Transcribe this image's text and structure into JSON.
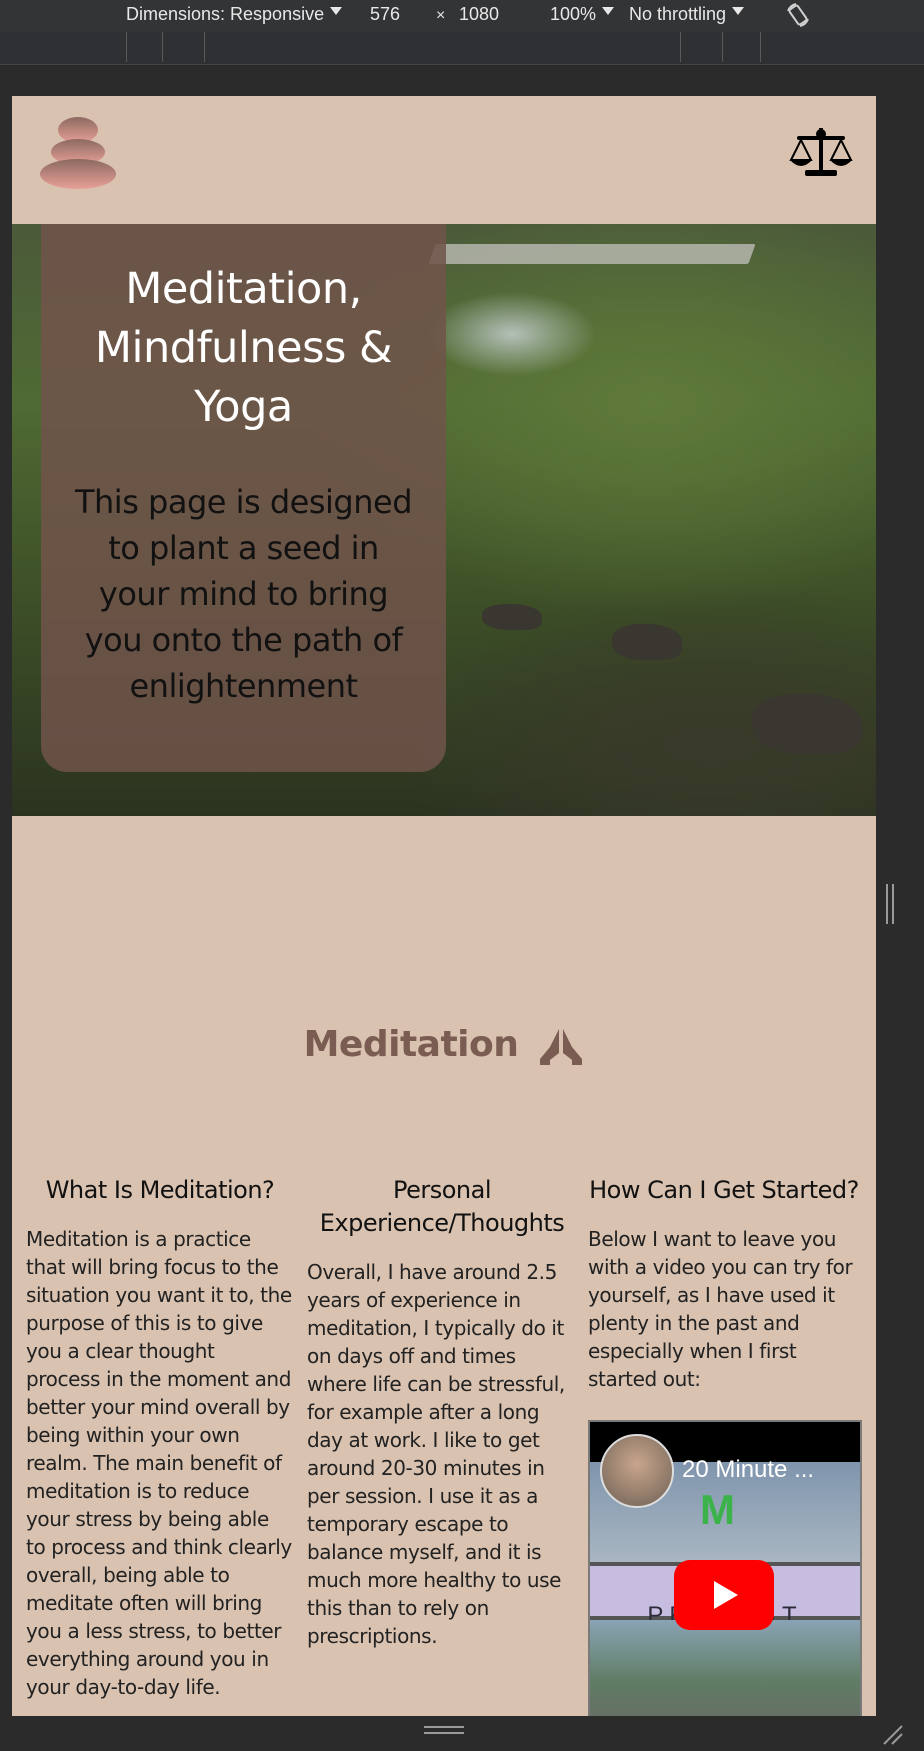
{
  "devtools": {
    "dimensions_label": "Dimensions: Responsive",
    "width": "576",
    "times": "×",
    "height": "1080",
    "zoom": "100%",
    "throttling": "No throttling",
    "icons": [
      "chevron-down-icon",
      "rotate-icon",
      "resize-handle-icon"
    ]
  },
  "site": {
    "icons": [
      "stones-logo-icon",
      "scale-icon",
      "praying-hands-icon"
    ],
    "hero": {
      "title": "Meditation, Mindfulness & Yoga",
      "subtitle": "This page is designed to plant a seed in your mind to bring you onto the path of enlightenment"
    },
    "section_title": "Meditation",
    "columns": [
      {
        "heading": "What Is Meditation?",
        "body": "Meditation is a practice that will bring focus to the situation you want it to, the purpose of this is to give you a clear thought process in the moment and better your mind overall by being within your own realm. The main benefit of meditation is to reduce your stress by being able to process and think clearly overall, being able to meditate often will bring you a less stress, to better everything around you in your day-to-day life."
      },
      {
        "heading": "Personal Experience/Thoughts",
        "body": "Overall, I have around 2.5 years of experience in meditation, I typically do it on days off and times where life can be stressful, for example after a long day at work. I like to get around 20-30 minutes in per session. I use it as a temporary escape to balance myself, and it is much more healthy to use this than to rely on prescriptions."
      },
      {
        "heading": "How Can I Get Started?",
        "body": "Below I want to leave you with a video you can try for yourself, as I have used it plenty in the past and especially when I first started out:"
      }
    ],
    "video": {
      "title": "20 Minute ...",
      "brand": "BEING PRESENT",
      "logo_text": "M"
    },
    "colors": {
      "page_background": "#d9c2b0",
      "hero_card": "#70544a",
      "section_title": "#7a5c52",
      "logo_top": "#8c6a60",
      "logo_bottom": "#e8a098"
    }
  }
}
